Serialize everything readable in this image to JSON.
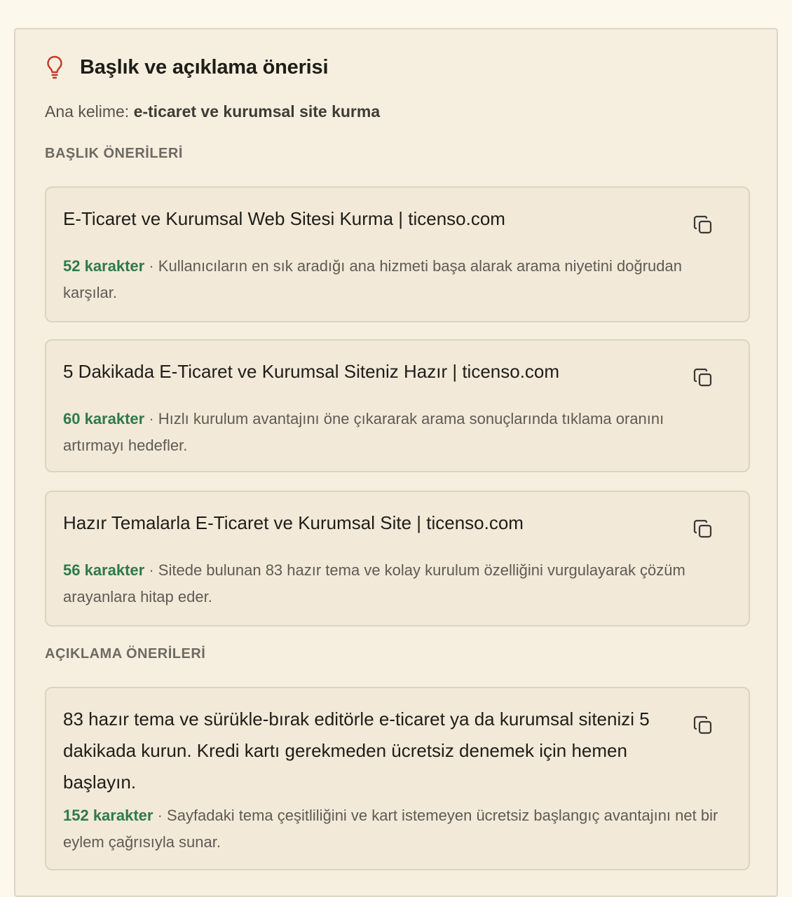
{
  "panel": {
    "title": "Başlık ve açıklama önerisi",
    "keyword_label": "Ana kelime:",
    "keyword_value": "e-ticaret ve kurumsal site kurma"
  },
  "title_section": {
    "label": "BAŞLIK ÖNERİLERİ",
    "items": [
      {
        "text": "E-Ticaret ve Kurumsal Web Sitesi Kurma | ticenso.com",
        "count": "52 karakter",
        "separator": "·",
        "reason": "Kullanıcıların en sık aradığı ana hizmeti başa alarak arama niyetini doğrudan karşılar."
      },
      {
        "text": "5 Dakikada E-Ticaret ve Kurumsal Siteniz Hazır | ticenso.com",
        "count": "60 karakter",
        "separator": "·",
        "reason": "Hızlı kurulum avantajını öne çıkararak arama sonuçlarında tıklama oranını artırmayı hedefler."
      },
      {
        "text": "Hazır Temalarla E-Ticaret ve Kurumsal Site | ticenso.com",
        "count": "56 karakter",
        "separator": "·",
        "reason": "Sitede bulunan 83 hazır tema ve kolay kurulum özelliğini vurgulayarak çözüm arayanlara hitap eder."
      }
    ]
  },
  "desc_section": {
    "label": "AÇIKLAMA ÖNERİLERİ",
    "items": [
      {
        "text": "83 hazır tema ve sürükle-bırak editörle e-ticaret ya da kurumsal sitenizi 5 dakikada kurun. Kredi kartı gerekmeden ücretsiz denemek için hemen başlayın.",
        "count": "152 karakter",
        "separator": "·",
        "reason": "Sayfadaki tema çeşitliliğini ve kart istemeyen ücretsiz başlangıç avantajını net bir eylem çağrısıyla sunar."
      }
    ]
  },
  "icons": {
    "header": "lightbulb-icon",
    "copy": "copy-icon"
  },
  "colors": {
    "accent_bulb": "#c0392b",
    "count_green": "#2f7a4a"
  }
}
